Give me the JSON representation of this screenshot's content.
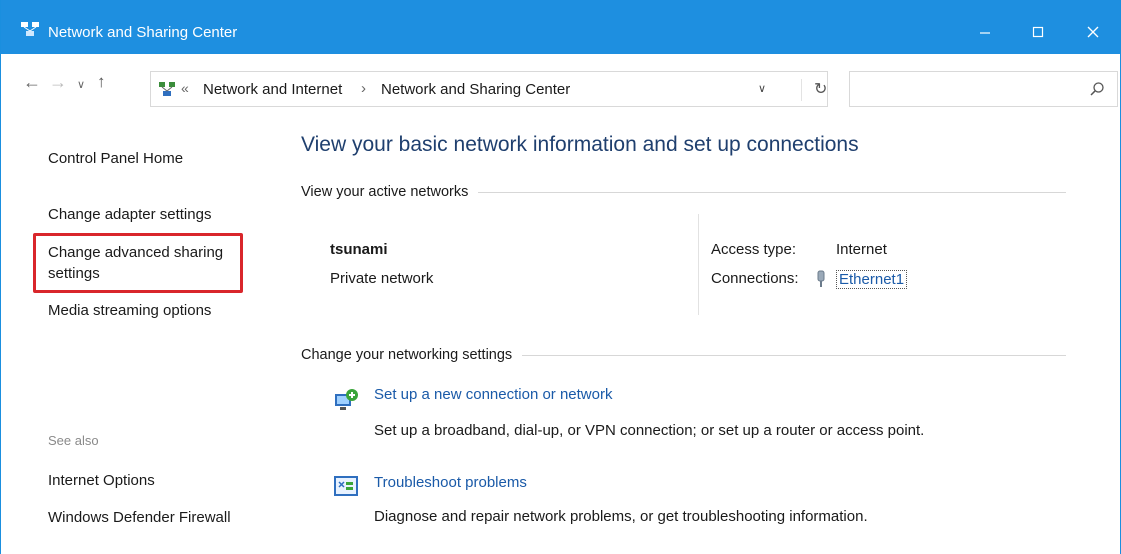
{
  "window": {
    "title": "Network and Sharing Center"
  },
  "address": {
    "breadcrumbs": [
      "Network and Internet",
      "Network and Sharing Center"
    ],
    "search_placeholder": ""
  },
  "left_pane": {
    "control_panel_home": "Control Panel Home",
    "change_adapter": "Change adapter settings",
    "change_advanced_sharing": "Change advanced sharing settings",
    "media_streaming": "Media streaming options",
    "see_also": "See also",
    "internet_options": "Internet Options",
    "firewall": "Windows Defender Firewall"
  },
  "main": {
    "title": "View your basic network information and set up connections",
    "active_networks_heading": "View your active networks",
    "network": {
      "name": "tsunami",
      "type": "Private network",
      "access_type_label": "Access type:",
      "access_type_value": "Internet",
      "connections_label": "Connections:",
      "connections_value": "Ethernet1"
    },
    "change_settings_heading": "Change your networking settings",
    "tasks": [
      {
        "title": "Set up a new connection or network",
        "description": "Set up a broadband, dial-up, or VPN connection; or set up a router or access point.",
        "icon": "network-setup-icon"
      },
      {
        "title": "Troubleshoot problems",
        "description": "Diagnose and repair network problems, or get troubleshooting information.",
        "icon": "troubleshoot-icon"
      }
    ]
  },
  "colors": {
    "titlebar": "#1e8fe0",
    "link": "#1a5aa8",
    "heading": "#1f3f6e",
    "highlight": "#d9262b"
  }
}
